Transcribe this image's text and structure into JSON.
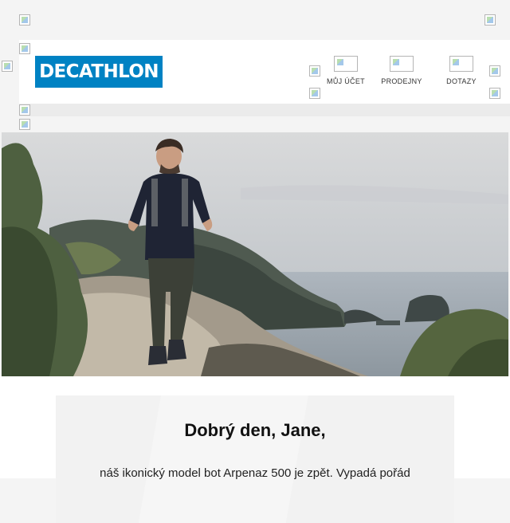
{
  "brand": {
    "logo_text": "DECATHLON",
    "color": "#0082c3"
  },
  "nav": [
    {
      "label": "MŮJ ÚČET",
      "icon": "account-icon"
    },
    {
      "label": "PRODEJNY",
      "icon": "store-icon"
    },
    {
      "label": "DOTAZY",
      "icon": "help-icon"
    }
  ],
  "hero": {
    "description_icon": "hiker-coast-photo"
  },
  "message": {
    "greeting": "Dobrý den, Jane,",
    "body": "náš ikonický model bot Arpenaz 500 je zpět. Vypadá pořád"
  }
}
